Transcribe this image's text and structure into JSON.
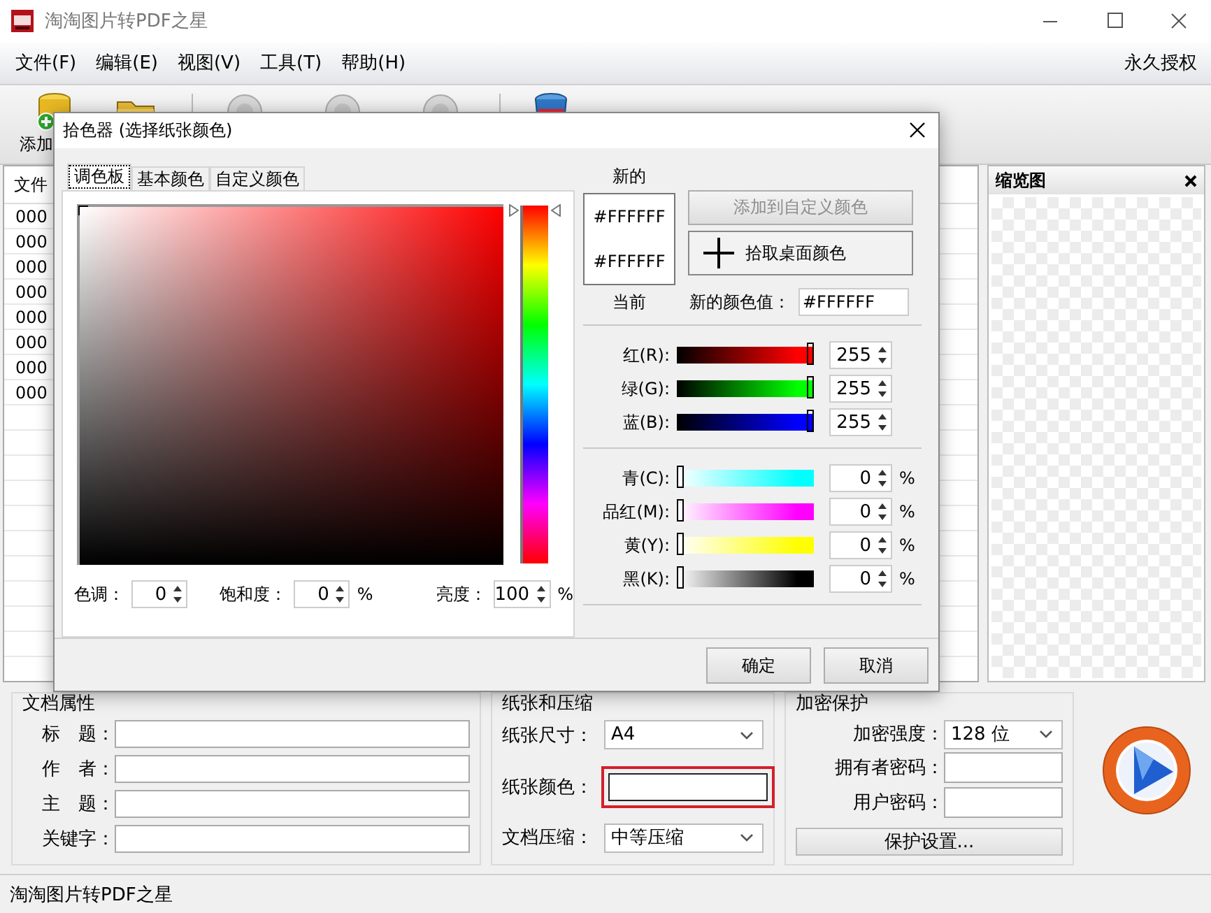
{
  "window": {
    "title": "淘淘图片转PDF之星"
  },
  "menu": [
    {
      "label": "文件(F)"
    },
    {
      "label": "编辑(E)"
    },
    {
      "label": "视图(V)"
    },
    {
      "label": "工具(T)"
    },
    {
      "label": "帮助(H)"
    }
  ],
  "license_menu": "永久授权",
  "toolbar": {
    "first_label": "添加"
  },
  "file_list": {
    "column_1": "文件",
    "rows": [
      "000",
      "000",
      "000",
      "000",
      "000",
      "000",
      "000",
      "000"
    ]
  },
  "thumbnail_panel": {
    "title": "缩览图"
  },
  "document_properties": {
    "title": "文档属性",
    "fields": [
      {
        "label": "标　题："
      },
      {
        "label": "作　者："
      },
      {
        "label": "主　题："
      },
      {
        "label": "关键字："
      }
    ]
  },
  "paper": {
    "title": "纸张和压缩",
    "size_label": "纸张尺寸：",
    "size_value": "A4",
    "color_label": "纸张颜色：",
    "color_highlighted": true,
    "compression_label": "文档压缩：",
    "compression_value": "中等压缩"
  },
  "encryption": {
    "title": "加密保护",
    "strength_label": "加密强度：",
    "strength_value": "128 位",
    "owner_label": "拥有者密码：",
    "user_label": "用户密码：",
    "button": "保护设置..."
  },
  "status_bar": "淘淘图片转PDF之星",
  "dialog": {
    "title": "拾色器 (选择纸张颜色)",
    "tabs": [
      {
        "label": "调色板",
        "selected": true
      },
      {
        "label": "基本颜色",
        "selected": false
      },
      {
        "label": "自定义颜色",
        "selected": false
      }
    ],
    "hue_slider": {
      "level": 0
    },
    "spinners": [
      {
        "label": "色调：",
        "value": "0"
      },
      {
        "label": "饱和度：",
        "value": "0",
        "unit": "%"
      },
      {
        "label": "亮度：",
        "value": "100",
        "unit": "%"
      }
    ],
    "new_label": "新的",
    "new_color": "#FFFFFF",
    "current_color": "#FFFFFF",
    "current_label": "当前",
    "add_button": {
      "label": "添加到自定义颜色",
      "disabled": true
    },
    "pick_button": "拾取桌面颜色",
    "new_value_label": "新的颜色值：",
    "new_value": "#FFFFFF",
    "channels": [
      {
        "kind": "rgb",
        "label": "红(R):",
        "color": "#ff0000",
        "level": 1,
        "value": "255"
      },
      {
        "kind": "rgb",
        "label": "绿(G):",
        "color": "#00ff00",
        "level": 1,
        "value": "255"
      },
      {
        "kind": "rgb",
        "label": "蓝(B):",
        "color": "#0000ff",
        "level": 1,
        "value": "255"
      },
      {
        "kind": "cmyk",
        "label": "青(C):",
        "color": "#00ffff",
        "level": 0,
        "value": "0",
        "unit": "%"
      },
      {
        "kind": "cmyk",
        "label": "品红(M):",
        "color": "#ff00ff",
        "level": 0,
        "value": "0",
        "unit": "%"
      },
      {
        "kind": "cmyk",
        "label": "黄(Y):",
        "color": "#ffff00",
        "level": 0,
        "value": "0",
        "unit": "%"
      },
      {
        "kind": "cmyk",
        "label": "黑(K):",
        "color": "#000000",
        "level": 0,
        "value": "0",
        "unit": "%"
      }
    ],
    "buttons": [
      "确定",
      "取消"
    ]
  }
}
